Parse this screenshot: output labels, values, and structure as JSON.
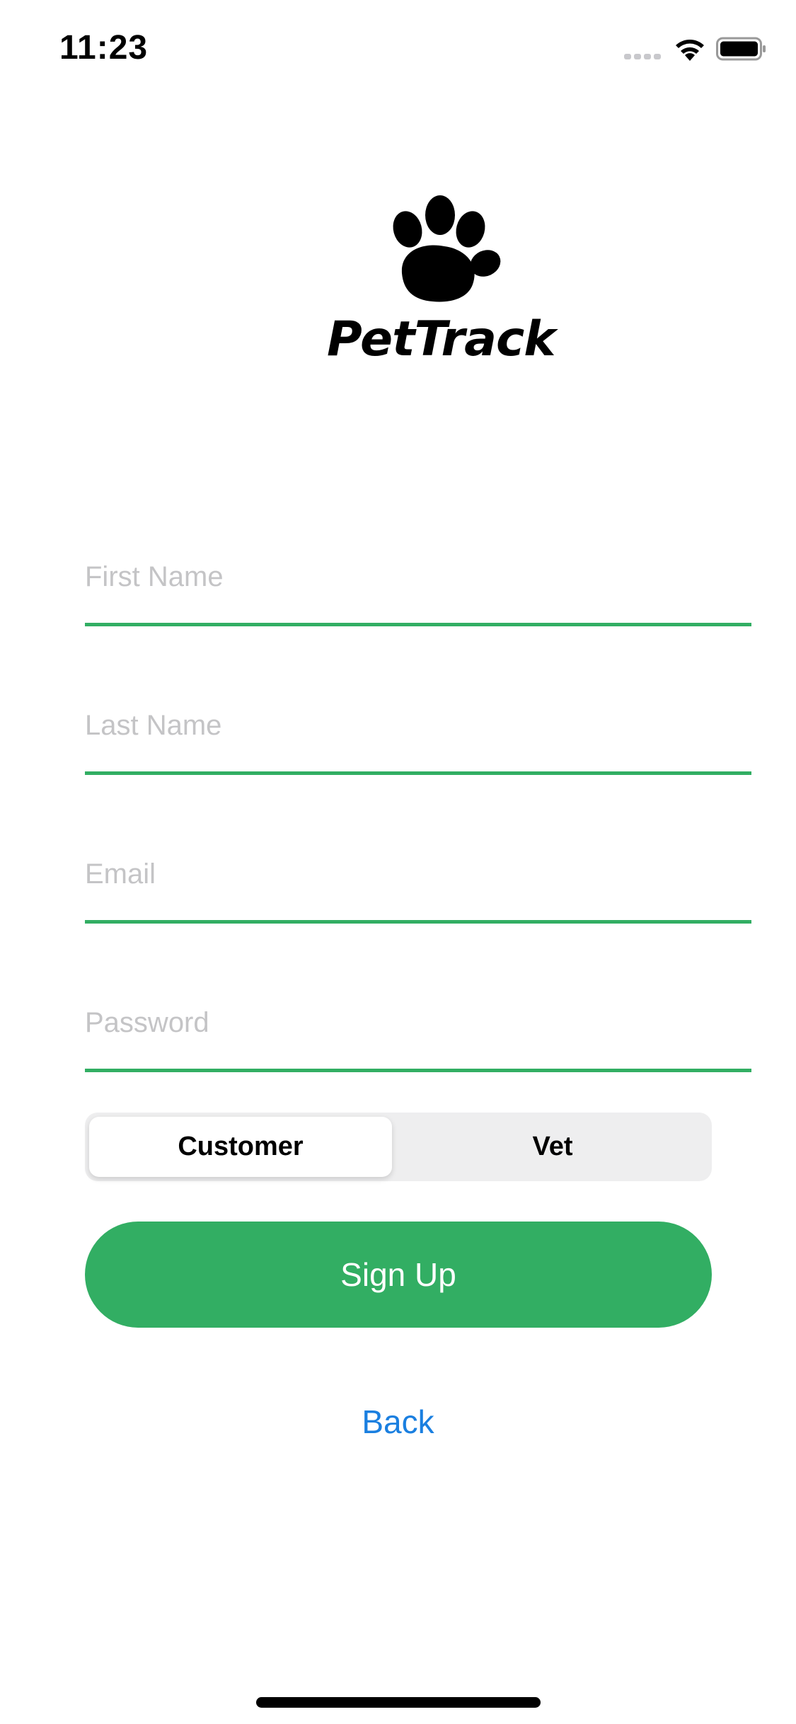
{
  "status_bar": {
    "time": "11:23"
  },
  "logo": {
    "text": "PetTrack",
    "icon": "paw-icon"
  },
  "form": {
    "first_name_placeholder": "First Name",
    "last_name_placeholder": "Last Name",
    "email_placeholder": "Email",
    "password_placeholder": "Password",
    "first_name_value": "",
    "last_name_value": "",
    "email_value": "",
    "password_value": ""
  },
  "role_selector": {
    "options": [
      "Customer",
      "Vet"
    ],
    "selected": "Customer"
  },
  "actions": {
    "signup_label": "Sign Up",
    "back_label": "Back"
  },
  "colors": {
    "accent": "#32ae63",
    "link": "#1a7fe0",
    "placeholder": "#c4c4c6",
    "segment_bg": "#eeeeef"
  }
}
